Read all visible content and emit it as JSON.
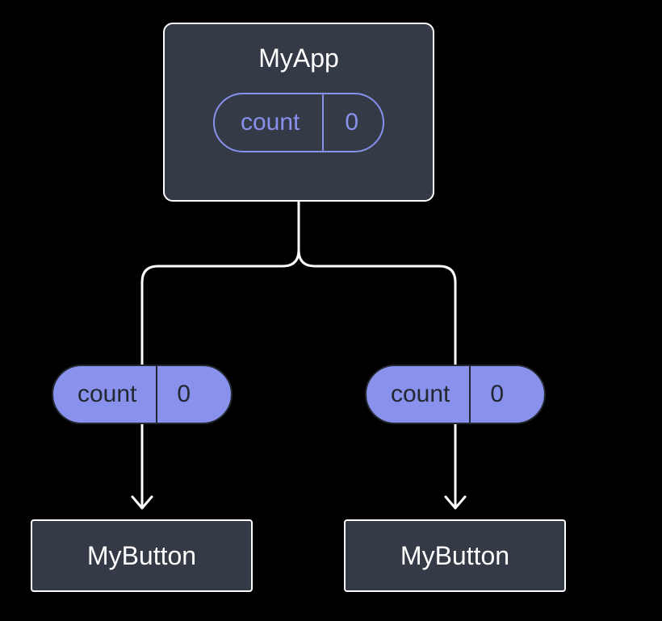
{
  "parent": {
    "title": "MyApp",
    "state": {
      "label": "count",
      "value": "0"
    }
  },
  "props": {
    "left": {
      "label": "count",
      "value": "0"
    },
    "right": {
      "label": "count",
      "value": "0"
    }
  },
  "children": {
    "left": {
      "title": "MyButton"
    },
    "right": {
      "title": "MyButton"
    }
  }
}
